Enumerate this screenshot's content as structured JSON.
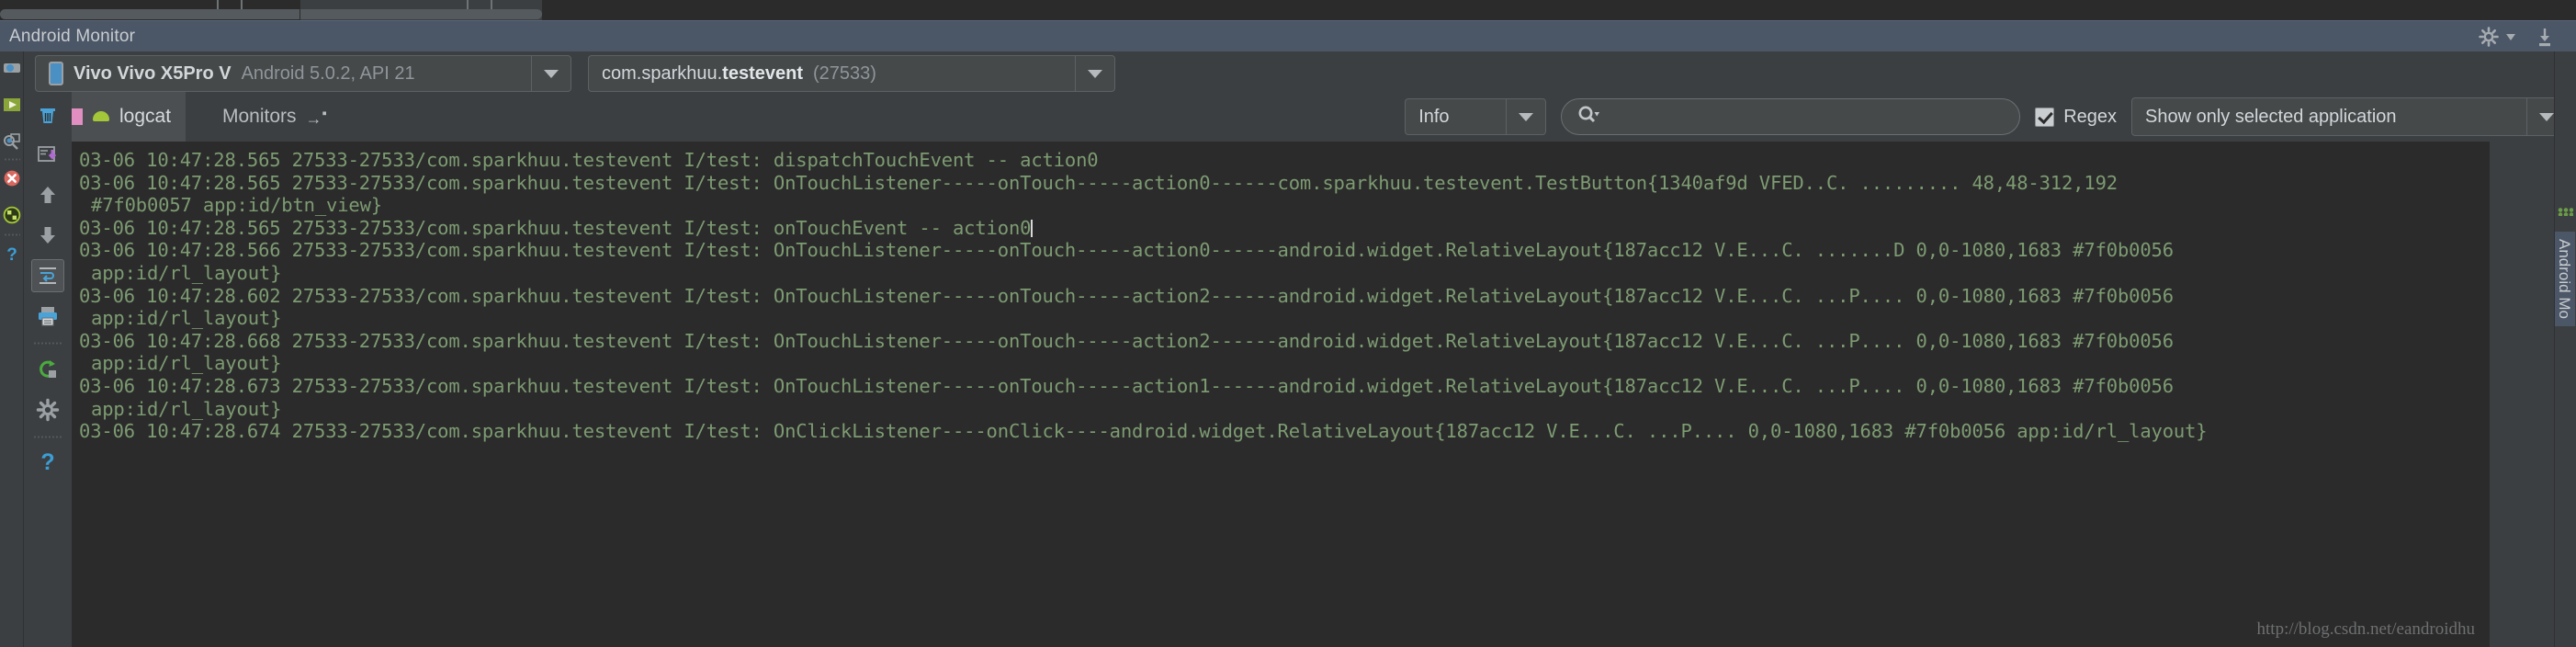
{
  "window": {
    "title": "Android Monitor",
    "header_actions": [
      "gear-icon",
      "chevron-down-icon",
      "minimize-icon"
    ]
  },
  "device_selector": {
    "icon": "phone-icon",
    "device_name": "Vivo Vivo X5Pro V",
    "device_info": "Android 5.0.2, API 21",
    "dropdown_icon": "chevron-down-icon"
  },
  "process_selector": {
    "package_prefix": "com.sparkhuu.",
    "package_suffix": "testevent",
    "pid": "(27533)",
    "dropdown_icon": "chevron-down-icon"
  },
  "tabs": [
    {
      "label": "logcat",
      "selected": true,
      "icon": "logcat-icon"
    },
    {
      "label": "Monitors",
      "selected": false,
      "icon": "arrow-right-icon"
    }
  ],
  "toolbar_left": [
    {
      "name": "clear-logcat-button",
      "icon": "trash-icon",
      "active": false
    },
    {
      "name": "scroll-to-end-button",
      "icon": "scroll-to-end-icon",
      "active": false
    },
    {
      "name": "up-button",
      "icon": "arrow-up-icon",
      "active": false
    },
    {
      "name": "down-button",
      "icon": "arrow-down-icon",
      "active": false
    },
    {
      "name": "soft-wrap-button",
      "icon": "soft-wrap-icon",
      "active": true
    },
    {
      "name": "print-button",
      "icon": "printer-icon",
      "active": false
    },
    {
      "name": "restart-button",
      "icon": "restart-icon",
      "active": false
    },
    {
      "name": "settings-button",
      "icon": "gear-icon",
      "active": false
    },
    {
      "name": "help-button",
      "icon": "question-mark-icon",
      "active": false
    }
  ],
  "ide_strip": [
    {
      "name": "screenshot-button",
      "icon": "camera-icon"
    },
    {
      "name": "screen-record-button",
      "icon": "play-icon"
    },
    {
      "name": "layout-inspector-button",
      "icon": "layout-inspector-icon"
    },
    {
      "name": "terminate-button",
      "icon": "close-circle-icon"
    },
    {
      "name": "system-information-button",
      "icon": "system-info-icon"
    },
    {
      "name": "help-button",
      "icon": "question-mark-icon"
    }
  ],
  "filters": {
    "log_level": "Info",
    "log_level_dropdown_icon": "chevron-down-icon",
    "search_icon": "search-icon",
    "search_value": "",
    "search_placeholder": "",
    "regex_label": "Regex",
    "regex_checked": true,
    "scope": "Show only selected application",
    "scope_dropdown_icon": "chevron-down-icon"
  },
  "log": {
    "lines": [
      {
        "text": "03-06 10:47:28.565 27533-27533/com.sparkhuu.testevent I/test: dispatchTouchEvent -- action0",
        "continuation": false,
        "cursor": false
      },
      {
        "text": "03-06 10:47:28.565 27533-27533/com.sparkhuu.testevent I/test: OnTouchListener-----onTouch-----action0------com.sparkhuu.testevent.TestButton{1340af9d VFED..C. ......... 48,48-312,192",
        "continuation": false,
        "cursor": false
      },
      {
        "text": "#7f0b0057 app:id/btn_view}",
        "continuation": true,
        "cursor": false
      },
      {
        "text": "03-06 10:47:28.565 27533-27533/com.sparkhuu.testevent I/test: onTouchEvent -- action0",
        "continuation": false,
        "cursor": true
      },
      {
        "text": "03-06 10:47:28.566 27533-27533/com.sparkhuu.testevent I/test: OnTouchListener-----onTouch-----action0------android.widget.RelativeLayout{187acc12 V.E...C. .......D 0,0-1080,1683 #7f0b0056",
        "continuation": false,
        "cursor": false
      },
      {
        "text": "app:id/rl_layout}",
        "continuation": true,
        "cursor": false
      },
      {
        "text": "03-06 10:47:28.602 27533-27533/com.sparkhuu.testevent I/test: OnTouchListener-----onTouch-----action2------android.widget.RelativeLayout{187acc12 V.E...C. ...P.... 0,0-1080,1683 #7f0b0056",
        "continuation": false,
        "cursor": false
      },
      {
        "text": "app:id/rl_layout}",
        "continuation": true,
        "cursor": false
      },
      {
        "text": "03-06 10:47:28.668 27533-27533/com.sparkhuu.testevent I/test: OnTouchListener-----onTouch-----action2------android.widget.RelativeLayout{187acc12 V.E...C. ...P.... 0,0-1080,1683 #7f0b0056",
        "continuation": false,
        "cursor": false
      },
      {
        "text": "app:id/rl_layout}",
        "continuation": true,
        "cursor": false
      },
      {
        "text": "03-06 10:47:28.673 27533-27533/com.sparkhuu.testevent I/test: OnTouchListener-----onTouch-----action1------android.widget.RelativeLayout{187acc12 V.E...C. ...P.... 0,0-1080,1683 #7f0b0056",
        "continuation": false,
        "cursor": false
      },
      {
        "text": "app:id/rl_layout}",
        "continuation": true,
        "cursor": false
      },
      {
        "text": "03-06 10:47:28.674 27533-27533/com.sparkhuu.testevent I/test: OnClickListener----onClick----android.widget.RelativeLayout{187acc12 V.E...C. ...P.... 0,0-1080,1683 #7f0b0056 app:id/rl_layout}",
        "continuation": false,
        "cursor": false
      }
    ],
    "watermark": "http://blog.csdn.net/eandroidhu"
  },
  "right_tab": {
    "label": "Android Mo"
  },
  "colors": {
    "log_text": "#7d9b72",
    "log_background": "#2b2b2b",
    "header_background": "#4b5666",
    "panel_background": "#3c3f41"
  }
}
